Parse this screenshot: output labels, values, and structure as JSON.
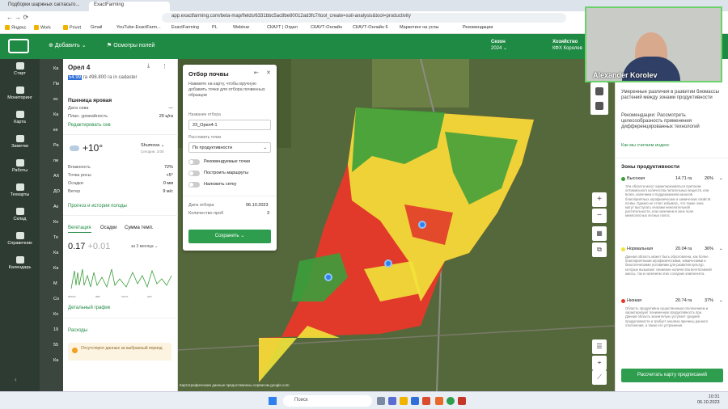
{
  "browser": {
    "tabs": [
      "Подборки шаржных сагласьто...",
      "ExactFarming"
    ],
    "url": "app.exactfarming.com/beta-map/fields/6331bbc5ac8be80012ad3fc7/tool_create=soil-analysis&tool=productivity",
    "bookmarks": [
      "Яндекс",
      "Work",
      "Privet",
      "Gmail",
      "YouTube-ExactFarm...",
      "ExactFarming",
      "PL",
      "Webinar",
      "СКАУТ | Отдел",
      "СКАУТ-Онлайн",
      "СКАУТ-Онлайн 6",
      "Маркетинг на услы",
      "Рекомендации"
    ]
  },
  "header": {
    "add_label": "Добавить",
    "inspection_label": "Осмотры полей",
    "season_label": "Сезон",
    "season_value": "2024",
    "farm_label": "Хозяйство",
    "farm_value": "КФХ Королев"
  },
  "sidebar": {
    "items": [
      "Старт",
      "Мониторинг",
      "Карта",
      "Заметки",
      "Работы",
      "Техкарты",
      "Склад",
      "Справочник",
      "Календарь"
    ],
    "left_col": [
      "Ка",
      "Пи",
      "ес",
      "Ка",
      "ке",
      "Ра",
      "пи",
      "АХ",
      "ДО",
      "Ак",
      "Ко",
      "Те",
      "Ка",
      "Ка",
      "М",
      "Со",
      "Ко",
      "19",
      "55",
      "Ка"
    ]
  },
  "field_panel": {
    "title": "Орел 4",
    "area_highlight": "54.99",
    "area_text": "га 498.800 га in cadaster",
    "crop": "Пшеница яровая",
    "sowing_label": "Дата сева",
    "sowing_value": "—",
    "yield_label": "План. урожайность",
    "yield_value": "20 ц/га",
    "edit_link": "Редактировать сев",
    "temperature": "+10°",
    "location": "Shumova",
    "time": "Сегодня, 3:00",
    "weather": [
      {
        "label": "Влажность",
        "value": "72%"
      },
      {
        "label": "Точка росы",
        "value": "+5°"
      },
      {
        "label": "Осадки",
        "value": "0 мм"
      },
      {
        "label": "Ветер",
        "value": "9 м/с"
      }
    ],
    "forecast_link": "Прогноз и история погоды",
    "tabs": [
      "Вегетация",
      "Осадки",
      "Сумма темп."
    ],
    "ndvi_value": "0.17",
    "ndvi_delta": "+0.01",
    "period": "за 3 месяца",
    "chart_ticks": [
      "июль",
      "авг.",
      "сент.",
      "окт."
    ],
    "detail_link": "Детальный график",
    "expenses_link": "Расходы",
    "no_data": "Отсутствуют данные за выбранный период"
  },
  "soil_panel": {
    "title": "Отбор почвы",
    "hint": "Нажмите на карту, чтобы вручную добавить точки для отбора почвенных образцов",
    "name_label": "Название отбора",
    "name_value": "23_Орел4-1",
    "arrange_label": "Расставить точки",
    "arrange_value": "По продуктивности",
    "toggles": [
      "Рекомендуемые точки",
      "Построить маршруты",
      "Наложить сетку"
    ],
    "date_label": "Дата отбора",
    "date_value": "06.10.2023",
    "count_label": "Количество проб",
    "count_value": "3",
    "save_label": "Сохранить"
  },
  "zones_panel": {
    "intro": "Умеренные различия в развитии биомассы растений между зонами продуктивности",
    "recommendation": "Рекомендации: Рассмотреть целесообразность применения дифференцированных технологий",
    "how_link": "Как мы считаем индекс",
    "zones_title": "Зоны продуктивности",
    "zones": [
      {
        "name": "Высокая",
        "area": "14.71 га",
        "pct": "26%",
        "color": "#3b9e3b",
        "desc": "Эти области могут характеризоваться притоком оптимального количества питательных веществ, или влаги, наличием и поддержанием каналов благоприятных агрофизических и химических свойств почвы. Однако не стоит забывать, что также зона могут выступать очагами нежелательной растительности, или наличием в зоне поле межполосных лесных полос."
      },
      {
        "name": "Нормальная",
        "area": "20.04 га",
        "pct": "36%",
        "color": "#f1e33a",
        "desc": "Данная область может быть обусловлена, как более благоприятными агрофизическими, химическими и биологическими условиями для развития культур, которые вызывают снижение количества вегетативной массы, так и наличием этих соседних компонента."
      },
      {
        "name": "Низкая",
        "area": "20.74 га",
        "pct": "37%",
        "color": "#e13a2a",
        "desc": "Область продуктивна существенным отклонением и характеризуют пониженную продуктивность при. Данная область значительно уступает средней продуктивности и требует анализа причины данного отклонения, а также его устранения."
      }
    ],
    "calc_button": "Рассчитать карту предписаний"
  },
  "map": {
    "attribution": "Картографические данные предоставлены сервисом google.com"
  },
  "video": {
    "name": "Alexander Korolev"
  },
  "taskbar": {
    "search": "Поиск",
    "time": "10:31",
    "date": "06.10.2023"
  }
}
